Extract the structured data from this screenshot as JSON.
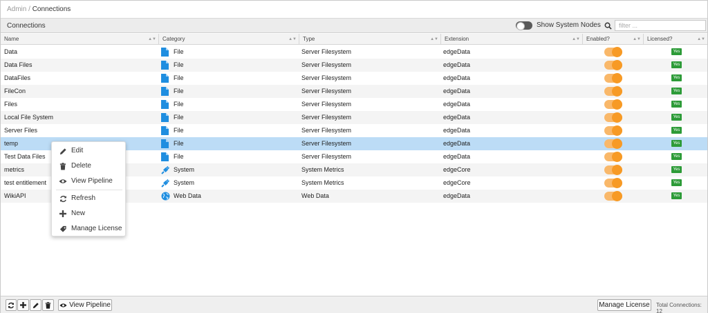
{
  "breadcrumb": {
    "parent": "Admin",
    "separator": "/",
    "current": "Connections"
  },
  "panel": {
    "title": "Connections",
    "show_system_nodes": "Show System Nodes",
    "filter_placeholder": "filter ...",
    "filter_value": ""
  },
  "columns": {
    "name": "Name",
    "category": "Category",
    "type": "Type",
    "extension": "Extension",
    "enabled": "Enabled?",
    "licensed": "Licensed?"
  },
  "rows": [
    {
      "name": "Data",
      "category": "File",
      "category_icon": "file-icon",
      "type": "Server Filesystem",
      "extension": "edgeData",
      "enabled": true,
      "licensed": "Yes"
    },
    {
      "name": "Data Files",
      "category": "File",
      "category_icon": "file-icon",
      "type": "Server Filesystem",
      "extension": "edgeData",
      "enabled": true,
      "licensed": "Yes"
    },
    {
      "name": "DataFiles",
      "category": "File",
      "category_icon": "file-icon",
      "type": "Server Filesystem",
      "extension": "edgeData",
      "enabled": true,
      "licensed": "Yes"
    },
    {
      "name": "FileCon",
      "category": "File",
      "category_icon": "file-icon",
      "type": "Server Filesystem",
      "extension": "edgeData",
      "enabled": true,
      "licensed": "Yes"
    },
    {
      "name": "Files",
      "category": "File",
      "category_icon": "file-icon",
      "type": "Server Filesystem",
      "extension": "edgeData",
      "enabled": true,
      "licensed": "Yes"
    },
    {
      "name": "Local File System",
      "category": "File",
      "category_icon": "file-icon",
      "type": "Server Filesystem",
      "extension": "edgeData",
      "enabled": true,
      "licensed": "Yes"
    },
    {
      "name": "Server Files",
      "category": "File",
      "category_icon": "file-icon",
      "type": "Server Filesystem",
      "extension": "edgeData",
      "enabled": true,
      "licensed": "Yes"
    },
    {
      "name": "temp",
      "category": "File",
      "category_icon": "file-icon",
      "type": "Server Filesystem",
      "extension": "edgeData",
      "enabled": true,
      "licensed": "Yes",
      "selected": true
    },
    {
      "name": "Test Data Files",
      "category": "File",
      "category_icon": "file-icon",
      "type": "Server Filesystem",
      "extension": "edgeData",
      "enabled": true,
      "licensed": "Yes"
    },
    {
      "name": "metrics",
      "category": "System",
      "category_icon": "plug-icon",
      "type": "System Metrics",
      "extension": "edgeCore",
      "enabled": true,
      "licensed": "Yes"
    },
    {
      "name": "test entitlement",
      "category": "System",
      "category_icon": "plug-icon",
      "type": "System Metrics",
      "extension": "edgeCore",
      "enabled": true,
      "licensed": "Yes"
    },
    {
      "name": "WikiAPI",
      "category": "Web Data",
      "category_icon": "globe-icon",
      "type": "Web Data",
      "extension": "edgeData",
      "enabled": true,
      "licensed": "Yes"
    }
  ],
  "context_menu": {
    "edit": "Edit",
    "delete": "Delete",
    "view_pipeline": "View Pipeline",
    "refresh": "Refresh",
    "new": "New",
    "manage_license": "Manage License"
  },
  "toolbar": {
    "view_pipeline": "View Pipeline",
    "manage_license": "Manage License",
    "total_connections": "Total Connections: 12"
  },
  "colors": {
    "selected_row": "#bcdcf6",
    "toggle_on": "#f79a25",
    "licensed_badge": "#2d9b38",
    "file_icon": "#1f8ee0"
  }
}
